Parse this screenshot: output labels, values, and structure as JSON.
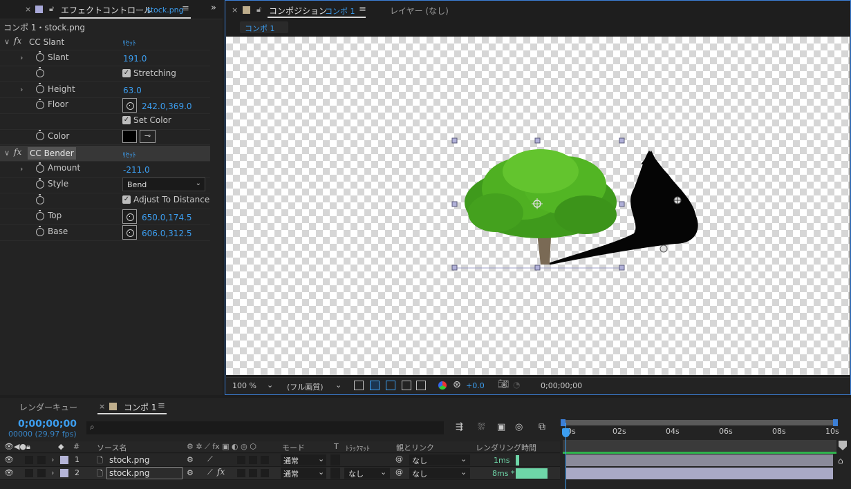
{
  "effect_panel": {
    "tab_title": "エフェクトコントロール",
    "tab_file": "stock.png",
    "subtitle": "コンポ 1・stock.png",
    "effects": [
      {
        "name": "CC Slant",
        "reset": "ﾘｾｯﾄ",
        "props": [
          {
            "label": "Slant",
            "value": "191.0"
          },
          {
            "label": "",
            "checkbox": "Stretching"
          },
          {
            "label": "Height",
            "value": "63.0"
          },
          {
            "label": "Floor",
            "value": "242.0,369.0"
          },
          {
            "label": "",
            "checkbox": "Set Color"
          },
          {
            "label": "Color",
            "value": ""
          }
        ]
      },
      {
        "name": "CC Bender",
        "reset": "ﾘｾｯﾄ",
        "props": [
          {
            "label": "Amount",
            "value": "-211.0"
          },
          {
            "label": "Style",
            "value": "Bend"
          },
          {
            "label": "",
            "checkbox": "Adjust To Distance"
          },
          {
            "label": "Top",
            "value": "650.0,174.5"
          },
          {
            "label": "Base",
            "value": "606.0,312.5"
          }
        ]
      }
    ]
  },
  "comp_panel": {
    "tab_title": "コンポジション",
    "tab_name": "コンポ 1",
    "layer_tab": "レイヤー (なし)",
    "breadcrumb": "コンポ 1",
    "zoom": "100 %",
    "quality": "(フル画質)",
    "exposure": "+0.0",
    "timecode": "0;00;00;00"
  },
  "timeline": {
    "render_queue_tab": "レンダーキュー",
    "comp_tab": "コンポ 1",
    "timecode": "0;00;00;00",
    "frames": "00000 (29.97 fps)",
    "search_placeholder": "",
    "headers": {
      "num": "#",
      "source": "ソース名",
      "mode": "モード",
      "t": "T",
      "trackmatte": "ﾄﾗｯｸﾏｯﾄ",
      "parent": "親とリンク",
      "render_time": "レンダリング時間"
    },
    "ruler": [
      "0s",
      "02s",
      "04s",
      "06s",
      "08s",
      "10s"
    ],
    "layers": [
      {
        "num": "1",
        "name": "stock.png",
        "mode": "通常",
        "trackmatte": "",
        "parent": "なし",
        "render_time": "1ms",
        "render_fraction": 0.1
      },
      {
        "num": "2",
        "name": "stock.png",
        "mode": "通常",
        "trackmatte": "なし",
        "parent": "なし",
        "render_time": "8ms *",
        "render_fraction": 1.0
      }
    ]
  }
}
